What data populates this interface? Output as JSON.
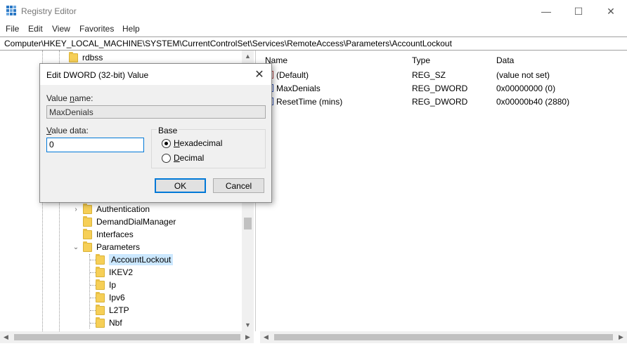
{
  "window": {
    "title": "Registry Editor",
    "controls": {
      "minimize": "—",
      "maximize": "☐",
      "close": "✕"
    },
    "icon": "registry-icon"
  },
  "menu": [
    "File",
    "Edit",
    "View",
    "Favorites",
    "Help"
  ],
  "address": "Computer\\HKEY_LOCAL_MACHINE\\SYSTEM\\CurrentControlSet\\Services\\RemoteAccess\\Parameters\\AccountLockout",
  "tree": {
    "top_item": "rdbss",
    "items": [
      {
        "label": "Authentication",
        "expander": "›"
      },
      {
        "label": "DemandDialManager",
        "expander": ""
      },
      {
        "label": "Interfaces",
        "expander": ""
      },
      {
        "label": "Parameters",
        "expander": "⌄"
      },
      {
        "label": "AccountLockout",
        "expander": "",
        "selected": true
      },
      {
        "label": "IKEV2",
        "expander": ""
      },
      {
        "label": "Ip",
        "expander": ""
      },
      {
        "label": "Ipv6",
        "expander": ""
      },
      {
        "label": "L2TP",
        "expander": ""
      },
      {
        "label": "Nbf",
        "expander": ""
      }
    ]
  },
  "list": {
    "columns": {
      "name": "Name",
      "type": "Type",
      "data": "Data"
    },
    "rows": [
      {
        "name": "(Default)",
        "type": "REG_SZ",
        "data": "(value not set)",
        "icon": "string-value-icon"
      },
      {
        "name": "MaxDenials",
        "type": "REG_DWORD",
        "data": "0x00000000 (0)",
        "icon": "dword-value-icon"
      },
      {
        "name": "ResetTime (mins)",
        "type": "REG_DWORD",
        "data": "0x00000b40 (2880)",
        "icon": "dword-value-icon"
      }
    ]
  },
  "dialog": {
    "title": "Edit DWORD (32-bit) Value",
    "close": "✕",
    "value_name_label": {
      "pre": "Value ",
      "u": "n",
      "post": "ame:"
    },
    "value_name": "MaxDenials",
    "value_data_label": {
      "pre": "",
      "u": "V",
      "post": "alue data:"
    },
    "value_data": "0",
    "base_label": "Base",
    "hex_label": {
      "pre": "",
      "u": "H",
      "post": "exadecimal"
    },
    "dec_label": {
      "pre": "",
      "u": "D",
      "post": "ecimal"
    },
    "selected_base": "Hexadecimal",
    "ok": "OK",
    "cancel": "Cancel"
  },
  "scroll": {
    "up": "▲",
    "down": "▼",
    "left": "◀",
    "right": "▶"
  }
}
